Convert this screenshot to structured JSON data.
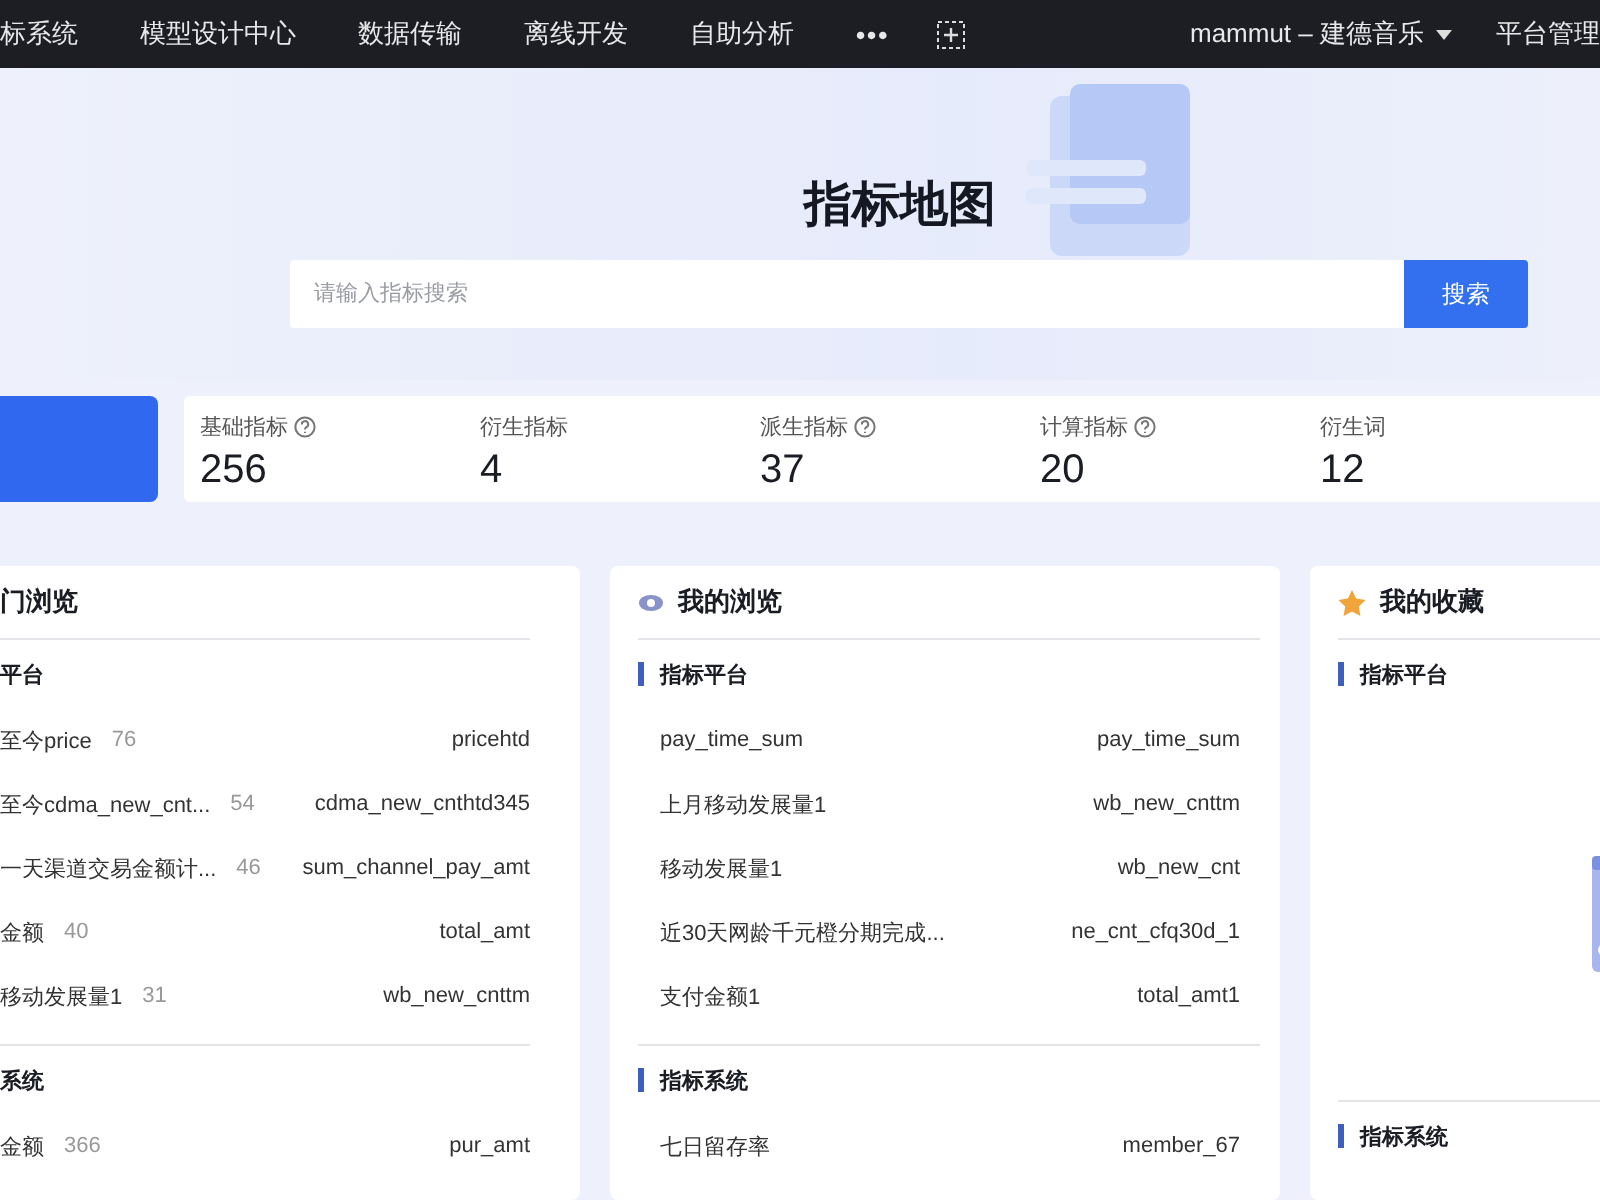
{
  "top_nav": {
    "items": [
      {
        "label": "标系统"
      },
      {
        "label": "模型设计中心"
      },
      {
        "label": "数据传输"
      },
      {
        "label": "离线开发"
      },
      {
        "label": "自助分析"
      }
    ],
    "more": "•••",
    "user": "mammut – 建德音乐",
    "admin": "平台管理"
  },
  "hero": {
    "title": "指标地图",
    "search": {
      "placeholder": "请输入指标搜索",
      "button": "搜索"
    }
  },
  "stats": [
    {
      "label": "基础指标",
      "help": true,
      "value": "256"
    },
    {
      "label": "衍生指标",
      "help": false,
      "value": "4"
    },
    {
      "label": "派生指标",
      "help": true,
      "value": "37"
    },
    {
      "label": "计算指标",
      "help": true,
      "value": "20"
    },
    {
      "label": "衍生词",
      "help": false,
      "value": "12"
    }
  ],
  "cards": [
    {
      "kind": "hot",
      "title": "门浏览",
      "sections": [
        {
          "title": "平台",
          "bar": false,
          "rows": [
            {
              "name": "至今price",
              "count": "76",
              "code": "pricehtd"
            },
            {
              "name": "至今cdma_new_cnt...",
              "count": "54",
              "code": "cdma_new_cnthtd345"
            },
            {
              "name": "一天渠道交易金额计...",
              "count": "46",
              "code": "sum_channel_pay_amt"
            },
            {
              "name": "金额",
              "count": "40",
              "code": "total_amt"
            },
            {
              "name": "移动发展量1",
              "count": "31",
              "code": "wb_new_cnttm"
            }
          ]
        },
        {
          "title": "系统",
          "bar": false,
          "rows": [
            {
              "name": "金额",
              "count": "366",
              "code": "pur_amt"
            }
          ]
        }
      ]
    },
    {
      "kind": "browse",
      "title": "我的浏览",
      "sections": [
        {
          "title": "指标平台",
          "bar": true,
          "rows": [
            {
              "name": "pay_time_sum",
              "code": "pay_time_sum"
            },
            {
              "name": "上月移动发展量1",
              "code": "wb_new_cnttm"
            },
            {
              "name": "移动发展量1",
              "code": "wb_new_cnt"
            },
            {
              "name": "近30天网龄千元橙分期完成...",
              "code": "ne_cnt_cfq30d_1"
            },
            {
              "name": "支付金额1",
              "code": "total_amt1"
            }
          ]
        },
        {
          "title": "指标系统",
          "bar": true,
          "rows": [
            {
              "name": "七日留存率",
              "code": "member_67"
            }
          ]
        }
      ]
    },
    {
      "kind": "favorite",
      "title": "我的收藏",
      "sections": [
        {
          "title": "指标平台",
          "bar": true,
          "empty": true
        },
        {
          "title": "指标系统",
          "bar": true
        }
      ]
    }
  ]
}
